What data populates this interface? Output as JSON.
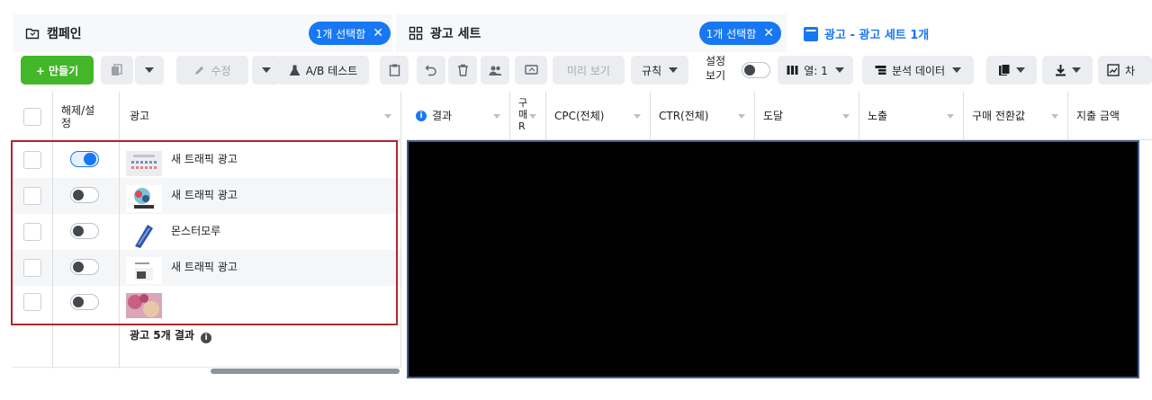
{
  "tabs": {
    "campaign": {
      "label": "캠페인",
      "pill": "1개 선택함",
      "icon": "folder-icon"
    },
    "adset": {
      "label": "광고 세트",
      "pill": "1개 선택함",
      "icon": "grid-icon"
    },
    "ad": {
      "label": "광고 - 광고 세트 1개",
      "icon": "ad-card-icon"
    }
  },
  "toolbar": {
    "create": "+ 만들기",
    "edit": "수정",
    "ab_test": "A/B 테스트",
    "preview": "미리 보기",
    "rules": "규칙",
    "setting_view": "설정 보기",
    "columns": "열: 1",
    "breakdown": "분석 데이터",
    "chart_truncated": "차"
  },
  "table": {
    "headers": {
      "toggle": "해제/설정",
      "ad": "광고",
      "result": "결과",
      "purchase_roas": "구매 R",
      "cpc": "CPC(전체)",
      "ctr": "CTR(전체)",
      "reach": "도달",
      "impressions": "노출",
      "purchase_value": "구매 전환값",
      "amount_spent": "지출 금액"
    },
    "rows": [
      {
        "name": "새 트래픽 광고",
        "on": true
      },
      {
        "name": "새 트래픽 광고",
        "on": false
      },
      {
        "name": "몬스터모루",
        "on": false
      },
      {
        "name": "새 트래픽 광고",
        "on": false
      },
      {
        "name": "",
        "on": false
      }
    ],
    "footer": "광고 5개 결과"
  },
  "colors": {
    "primary": "#1877f2",
    "create_green": "#42b72a",
    "highlight_red": "#b0282d",
    "redaction": "#000000"
  }
}
